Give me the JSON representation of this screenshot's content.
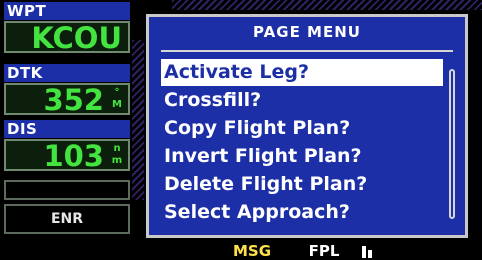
{
  "left_panel": {
    "fields": [
      {
        "label": "WPT",
        "value": "KCOU",
        "unit_top": "",
        "unit_bottom": ""
      },
      {
        "label": "DTK",
        "value": "352",
        "unit_top": "°",
        "unit_bottom": "M"
      },
      {
        "label": "DIS",
        "value": "103",
        "unit_top": "n",
        "unit_bottom": "m"
      }
    ],
    "mode": "ENR"
  },
  "page_menu": {
    "title": "PAGE MENU",
    "items": [
      {
        "label": "Activate Leg?",
        "selected": true
      },
      {
        "label": "Crossfill?",
        "selected": false
      },
      {
        "label": "Copy Flight Plan?",
        "selected": false
      },
      {
        "label": "Invert Flight Plan?",
        "selected": false
      },
      {
        "label": "Delete Flight Plan?",
        "selected": false
      },
      {
        "label": "Select Approach?",
        "selected": false
      }
    ]
  },
  "status_bar": {
    "msg": "MSG",
    "page_group": "FPL"
  },
  "colors": {
    "menu_bg": "#1c2fa6",
    "value_green": "#43e43f",
    "msg_yellow": "#ffe14a"
  }
}
